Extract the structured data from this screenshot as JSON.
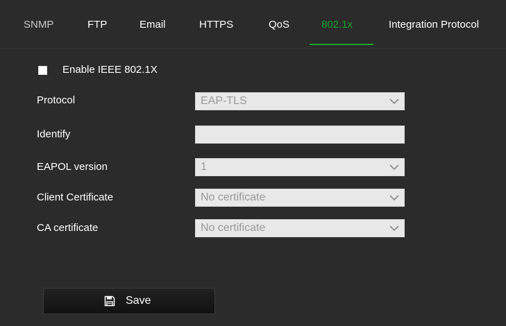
{
  "tabs": [
    {
      "label": "SNMP",
      "state": "dim"
    },
    {
      "label": "FTP",
      "state": "normal"
    },
    {
      "label": "Email",
      "state": "normal"
    },
    {
      "label": "HTTPS",
      "state": "normal"
    },
    {
      "label": "QoS",
      "state": "normal"
    },
    {
      "label": "802.1x",
      "state": "active"
    },
    {
      "label": "Integration Protocol",
      "state": "normal"
    }
  ],
  "colors": {
    "accent": "#18a52d",
    "background": "#2b2b2b",
    "field_background": "#e8e8e8",
    "field_text": "#9a9a9a"
  },
  "form": {
    "enable_label": "Enable IEEE 802.1X",
    "enable_checked": false,
    "protocol": {
      "label": "Protocol",
      "value": "EAP-TLS",
      "icon": "chevron-down-icon"
    },
    "identify": {
      "label": "Identify",
      "value": ""
    },
    "eapol": {
      "label": "EAPOL version",
      "value": "1",
      "icon": "chevron-down-icon"
    },
    "client_cert": {
      "label": "Client Certificate",
      "value": "No certificate",
      "icon": "chevron-down-icon"
    },
    "ca_cert": {
      "label": "CA certificate",
      "value": "No certificate",
      "icon": "chevron-down-icon"
    }
  },
  "save": {
    "label": "Save",
    "icon": "floppy-disk-icon"
  }
}
